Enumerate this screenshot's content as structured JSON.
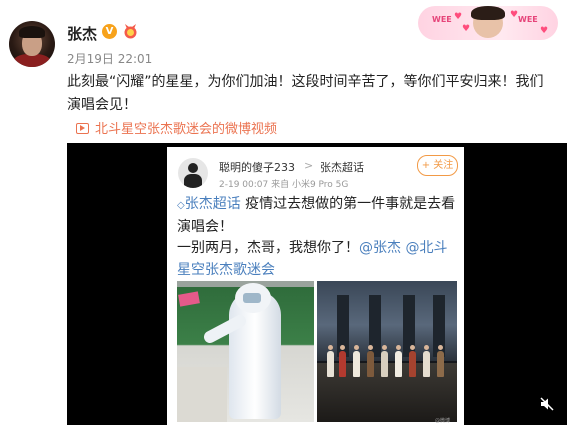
{
  "post": {
    "username": "张杰",
    "verified_badge": "V",
    "time": "2月19日 22:01",
    "text": "此刻最“闪耀”的星星，为你们加油！这段时间辛苦了，等你们平安归来！我们演唱会见！",
    "video_link": "北斗星空张杰歌迷会的微博视频"
  },
  "header_sticker": {
    "left_text": "WEE",
    "right_text": "WEE"
  },
  "embedded": {
    "username": "聪明的傻子233",
    "separator": ">",
    "topic": "张杰超话",
    "follow": "+ 关注",
    "meta": "2-19 00:07  来自 小米9 Pro 5G",
    "topic_tag": "张杰超话",
    "line1": " 疫情过去想做的第一件事就是去看演唱会！",
    "line2": "一别两月，杰哥，我想你了！",
    "mentions": "@张杰 @北斗星空张杰歌迷会",
    "watermark": "@微博"
  },
  "colors": {
    "link_orange": "#eb7350",
    "topic_blue": "#4a7fbd",
    "follow_orange": "#f29a46",
    "vip_gold": "#f7a21b"
  }
}
